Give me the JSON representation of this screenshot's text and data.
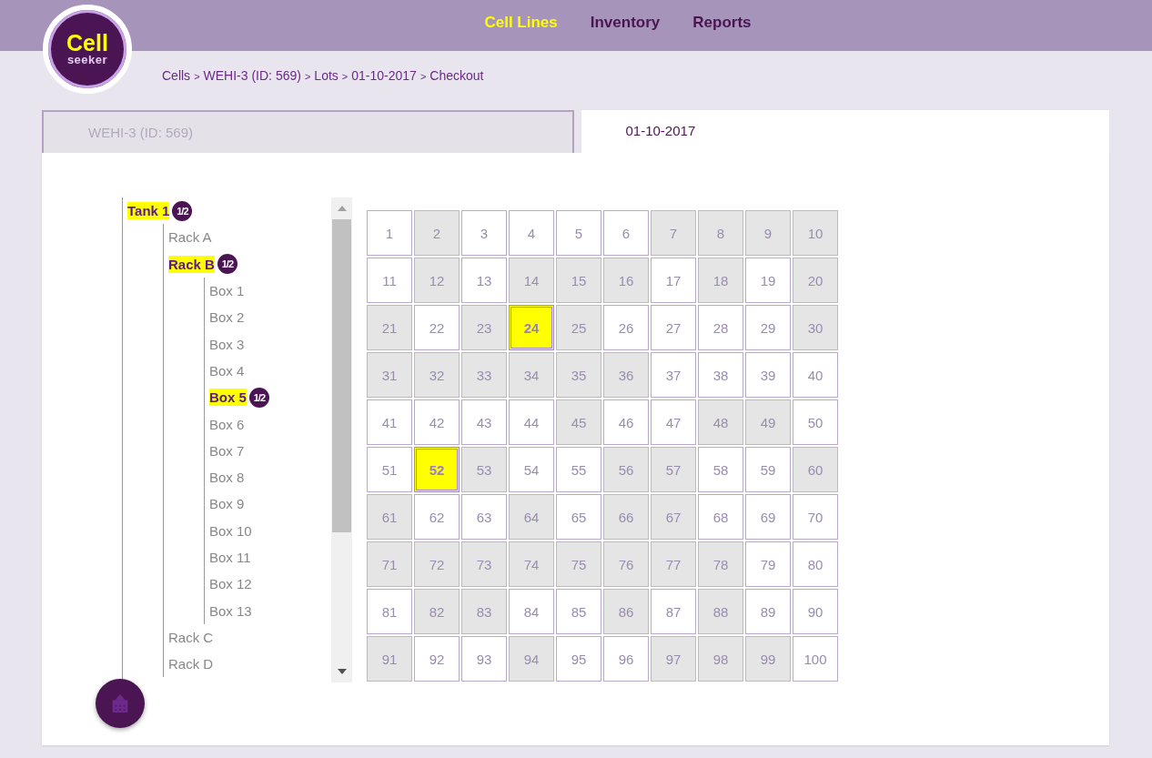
{
  "logo": {
    "title": "Cell",
    "subtitle": "seeker"
  },
  "nav": [
    {
      "label": "Cell Lines",
      "selected": true
    },
    {
      "label": "Inventory",
      "selected": false
    },
    {
      "label": "Reports",
      "selected": false
    }
  ],
  "breadcrumb": [
    "Cells",
    "WEHI-3 (ID: 569)",
    "Lots",
    "01-10-2017",
    "Checkout"
  ],
  "breadcrumb_separator": ">",
  "tabs": [
    {
      "label": "WEHI-3 (ID: 569)",
      "selected": false
    },
    {
      "label": "01-10-2017",
      "selected": true
    }
  ],
  "tree": [
    {
      "label": "Tank 1",
      "highlighted": true,
      "badge": "1/2",
      "children": [
        {
          "label": "Rack A",
          "highlighted": false
        },
        {
          "label": "Rack B",
          "highlighted": true,
          "badge": "1/2",
          "children": [
            {
              "label": "Box 1",
              "highlighted": false
            },
            {
              "label": "Box 2",
              "highlighted": false
            },
            {
              "label": "Box 3",
              "highlighted": false
            },
            {
              "label": "Box 4",
              "highlighted": false
            },
            {
              "label": "Box 5",
              "highlighted": true,
              "badge": "1/2"
            },
            {
              "label": "Box 6",
              "highlighted": false
            },
            {
              "label": "Box 7",
              "highlighted": false
            },
            {
              "label": "Box 8",
              "highlighted": false
            },
            {
              "label": "Box 9",
              "highlighted": false
            },
            {
              "label": "Box 10",
              "highlighted": false
            },
            {
              "label": "Box 11",
              "highlighted": false
            },
            {
              "label": "Box 12",
              "highlighted": false
            },
            {
              "label": "Box 13",
              "highlighted": false
            }
          ]
        },
        {
          "label": "Rack C",
          "highlighted": false
        },
        {
          "label": "Rack D",
          "highlighted": false
        }
      ]
    }
  ],
  "grid": [
    [
      {
        "label": "1",
        "occupied": false,
        "selected": false
      },
      {
        "label": "2",
        "occupied": true,
        "selected": false
      },
      {
        "label": "3",
        "occupied": false,
        "selected": false
      },
      {
        "label": "4",
        "occupied": false,
        "selected": false
      },
      {
        "label": "5",
        "occupied": false,
        "selected": false
      },
      {
        "label": "6",
        "occupied": false,
        "selected": false
      },
      {
        "label": "7",
        "occupied": true,
        "selected": false
      },
      {
        "label": "8",
        "occupied": true,
        "selected": false
      },
      {
        "label": "9",
        "occupied": true,
        "selected": false
      },
      {
        "label": "10",
        "occupied": true,
        "selected": false
      }
    ],
    [
      {
        "label": "11",
        "occupied": false,
        "selected": false
      },
      {
        "label": "12",
        "occupied": true,
        "selected": false
      },
      {
        "label": "13",
        "occupied": false,
        "selected": false
      },
      {
        "label": "14",
        "occupied": true,
        "selected": false
      },
      {
        "label": "15",
        "occupied": true,
        "selected": false
      },
      {
        "label": "16",
        "occupied": true,
        "selected": false
      },
      {
        "label": "17",
        "occupied": false,
        "selected": false
      },
      {
        "label": "18",
        "occupied": true,
        "selected": false
      },
      {
        "label": "19",
        "occupied": false,
        "selected": false
      },
      {
        "label": "20",
        "occupied": true,
        "selected": false
      }
    ],
    [
      {
        "label": "21",
        "occupied": true,
        "selected": false
      },
      {
        "label": "22",
        "occupied": false,
        "selected": false
      },
      {
        "label": "23",
        "occupied": true,
        "selected": false
      },
      {
        "label": "24",
        "occupied": true,
        "selected": true
      },
      {
        "label": "25",
        "occupied": true,
        "selected": false
      },
      {
        "label": "26",
        "occupied": false,
        "selected": false
      },
      {
        "label": "27",
        "occupied": false,
        "selected": false
      },
      {
        "label": "28",
        "occupied": false,
        "selected": false
      },
      {
        "label": "29",
        "occupied": false,
        "selected": false
      },
      {
        "label": "30",
        "occupied": true,
        "selected": false
      }
    ],
    [
      {
        "label": "31",
        "occupied": true,
        "selected": false
      },
      {
        "label": "32",
        "occupied": true,
        "selected": false
      },
      {
        "label": "33",
        "occupied": true,
        "selected": false
      },
      {
        "label": "34",
        "occupied": true,
        "selected": false
      },
      {
        "label": "35",
        "occupied": true,
        "selected": false
      },
      {
        "label": "36",
        "occupied": true,
        "selected": false
      },
      {
        "label": "37",
        "occupied": false,
        "selected": false
      },
      {
        "label": "38",
        "occupied": false,
        "selected": false
      },
      {
        "label": "39",
        "occupied": false,
        "selected": false
      },
      {
        "label": "40",
        "occupied": false,
        "selected": false
      }
    ],
    [
      {
        "label": "41",
        "occupied": false,
        "selected": false
      },
      {
        "label": "42",
        "occupied": false,
        "selected": false
      },
      {
        "label": "43",
        "occupied": false,
        "selected": false
      },
      {
        "label": "44",
        "occupied": false,
        "selected": false
      },
      {
        "label": "45",
        "occupied": true,
        "selected": false
      },
      {
        "label": "46",
        "occupied": false,
        "selected": false
      },
      {
        "label": "47",
        "occupied": false,
        "selected": false
      },
      {
        "label": "48",
        "occupied": true,
        "selected": false
      },
      {
        "label": "49",
        "occupied": true,
        "selected": false
      },
      {
        "label": "50",
        "occupied": false,
        "selected": false
      }
    ],
    [
      {
        "label": "51",
        "occupied": false,
        "selected": false
      },
      {
        "label": "52",
        "occupied": true,
        "selected": true
      },
      {
        "label": "53",
        "occupied": true,
        "selected": false
      },
      {
        "label": "54",
        "occupied": false,
        "selected": false
      },
      {
        "label": "55",
        "occupied": false,
        "selected": false
      },
      {
        "label": "56",
        "occupied": true,
        "selected": false
      },
      {
        "label": "57",
        "occupied": true,
        "selected": false
      },
      {
        "label": "58",
        "occupied": false,
        "selected": false
      },
      {
        "label": "59",
        "occupied": false,
        "selected": false
      },
      {
        "label": "60",
        "occupied": true,
        "selected": false
      }
    ],
    [
      {
        "label": "61",
        "occupied": true,
        "selected": false
      },
      {
        "label": "62",
        "occupied": false,
        "selected": false
      },
      {
        "label": "63",
        "occupied": false,
        "selected": false
      },
      {
        "label": "64",
        "occupied": true,
        "selected": false
      },
      {
        "label": "65",
        "occupied": false,
        "selected": false
      },
      {
        "label": "66",
        "occupied": true,
        "selected": false
      },
      {
        "label": "67",
        "occupied": true,
        "selected": false
      },
      {
        "label": "68",
        "occupied": false,
        "selected": false
      },
      {
        "label": "69",
        "occupied": false,
        "selected": false
      },
      {
        "label": "70",
        "occupied": false,
        "selected": false
      }
    ],
    [
      {
        "label": "71",
        "occupied": true,
        "selected": false
      },
      {
        "label": "72",
        "occupied": true,
        "selected": false
      },
      {
        "label": "73",
        "occupied": true,
        "selected": false
      },
      {
        "label": "74",
        "occupied": true,
        "selected": false
      },
      {
        "label": "75",
        "occupied": true,
        "selected": false
      },
      {
        "label": "76",
        "occupied": true,
        "selected": false
      },
      {
        "label": "77",
        "occupied": true,
        "selected": false
      },
      {
        "label": "78",
        "occupied": true,
        "selected": false
      },
      {
        "label": "79",
        "occupied": false,
        "selected": false
      },
      {
        "label": "80",
        "occupied": false,
        "selected": false
      }
    ],
    [
      {
        "label": "81",
        "occupied": false,
        "selected": false
      },
      {
        "label": "82",
        "occupied": true,
        "selected": false
      },
      {
        "label": "83",
        "occupied": true,
        "selected": false
      },
      {
        "label": "84",
        "occupied": false,
        "selected": false
      },
      {
        "label": "85",
        "occupied": false,
        "selected": false
      },
      {
        "label": "86",
        "occupied": true,
        "selected": false
      },
      {
        "label": "87",
        "occupied": false,
        "selected": false
      },
      {
        "label": "88",
        "occupied": true,
        "selected": false
      },
      {
        "label": "89",
        "occupied": false,
        "selected": false
      },
      {
        "label": "90",
        "occupied": false,
        "selected": false
      }
    ],
    [
      {
        "label": "91",
        "occupied": true,
        "selected": false
      },
      {
        "label": "92",
        "occupied": false,
        "selected": false
      },
      {
        "label": "93",
        "occupied": false,
        "selected": false
      },
      {
        "label": "94",
        "occupied": true,
        "selected": false
      },
      {
        "label": "95",
        "occupied": false,
        "selected": false
      },
      {
        "label": "96",
        "occupied": false,
        "selected": false
      },
      {
        "label": "97",
        "occupied": true,
        "selected": false
      },
      {
        "label": "98",
        "occupied": true,
        "selected": false
      },
      {
        "label": "99",
        "occupied": true,
        "selected": false
      },
      {
        "label": "100",
        "occupied": false,
        "selected": false
      }
    ]
  ]
}
